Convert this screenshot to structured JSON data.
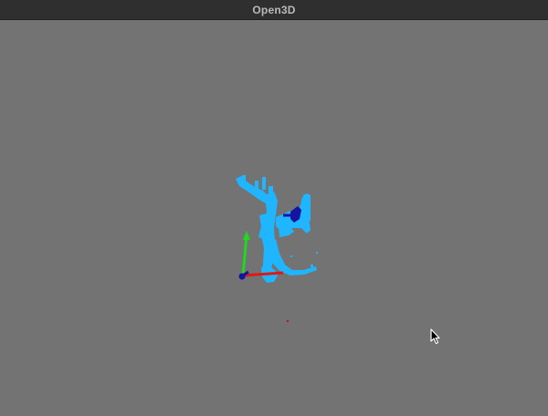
{
  "window": {
    "title": "Open3D"
  },
  "scene": {
    "background_color": "#737373",
    "point_cloud_color": "#1fb6ff",
    "axis_colors": {
      "x": "#e01818",
      "y": "#1fd81f",
      "z": "#1414a0"
    },
    "marker_color": "#c01010"
  },
  "icons": {
    "cursor": "arrow-cursor-icon"
  }
}
